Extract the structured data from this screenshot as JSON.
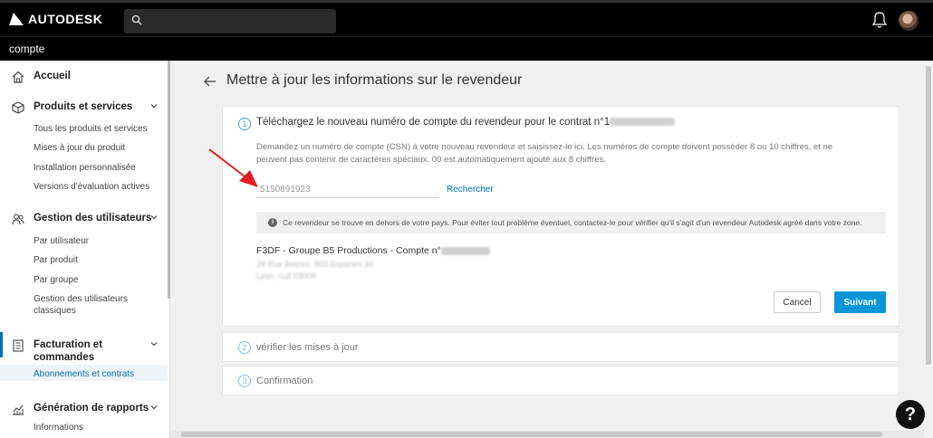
{
  "header": {
    "brand": "AUTODESK"
  },
  "subbar": {
    "title": "compte"
  },
  "sidebar": {
    "home": "Accueil",
    "products": {
      "label": "Produits et services",
      "items": [
        "Tous les produits et services",
        "Mises à jour du produit",
        "Installation personnalisée",
        "Versions d'évaluation actives"
      ]
    },
    "users": {
      "label": "Gestion des utilisateurs",
      "items": [
        "Par utilisateur",
        "Par produit",
        "Par groupe",
        "Gestion des utilisateurs",
        "classiques"
      ]
    },
    "billing": {
      "label1": "Facturation et",
      "label2": "commandes",
      "items": [
        "Abonnements et contrats"
      ]
    },
    "reports": {
      "label": "Génération de rapports",
      "items": [
        "Informations"
      ]
    }
  },
  "main": {
    "title": "Mettre à jour les informations sur le revendeur",
    "step1": {
      "number": "1",
      "title": "Téléchargez le nouveau numéro de compte du revendeur pour le contrat n°1",
      "description_line1": "Demandez un numéro de compte (CSN) à votre nouveau revendeur et saisissez-le ici. Les numéros de compte doivent posséder 8 ou 10 chiffres, et ne",
      "description_line2": "peuvent pas contenir de caractères spéciaux. 00 est automatiquement ajouté aux 8 chiffres.",
      "input_value": "5150891923",
      "search_link": "Rechercher",
      "warning": "Ce revendeur se trouve en dehors de votre pays. Pour éviter tout problème éventuel, contactez-le pour vérifier qu'il s'agit d'un revendeur Autodesk agréé dans votre zone.",
      "dealer_name": "F3DF - Groupe B5 Productions - Compte n°",
      "address_line1": "28 Rue Belzen, 803 Espanes 3d",
      "address_line2": "Lyon, null 69008",
      "cancel": "Cancel",
      "next": "Suivant"
    },
    "step2": {
      "number": "2",
      "label": "vérifier les mises à jour"
    },
    "step3": {
      "number": "3",
      "label": "Confirmation"
    }
  },
  "help": {
    "label": "?"
  },
  "colors": {
    "accent": "#0696d7",
    "link": "#0070b8",
    "annotation": "#e02020"
  }
}
